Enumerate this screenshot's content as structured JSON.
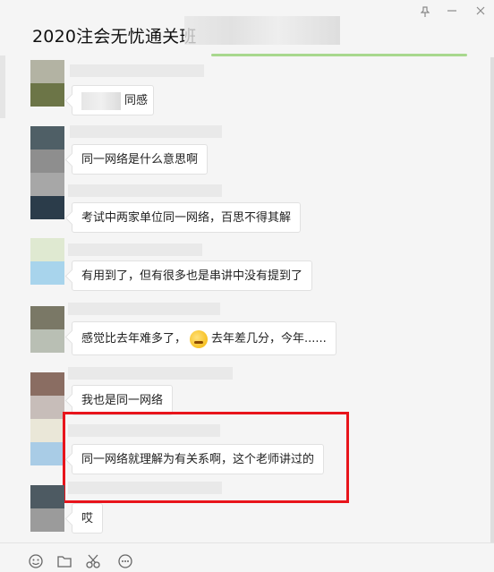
{
  "window": {
    "title": "2020注会无忧通关班",
    "pin_icon": "pin-icon"
  },
  "messages": [
    {
      "avatar": [
        "#b3b3a3",
        "#6c7547"
      ],
      "text": "同感",
      "leading_blur": true
    },
    {
      "avatar": [
        "#4f5f66",
        "#8e8e8e"
      ],
      "text": "同一网络是什么意思啊"
    },
    {
      "avatar": [
        "#a7a7a7",
        "#2b3c4a"
      ],
      "text": "考试中两家单位同一网络，百思不得其解"
    },
    {
      "avatar": [
        "#dfe9d1",
        "#a8d4ec"
      ],
      "text": "有用到了，但有很多也是串讲中没有提到了"
    },
    {
      "avatar": [
        "#7a7866",
        "#b9bfb4"
      ],
      "text": "感觉比去年难多了，",
      "emoji": "crying-laughing-emoji",
      "text_after": "去年差几分，今年......"
    },
    {
      "avatar": [
        "#8a6d62",
        "#c7bdb9"
      ],
      "text": "我也是同一网络"
    },
    {
      "avatar": [
        "#eae7d8",
        "#a9cce6"
      ],
      "text": "同一网络就理解为有关系啊，这个老师讲过的"
    },
    {
      "avatar": [
        "#4d5a62",
        "#9b9b9b"
      ],
      "text": "哎"
    }
  ],
  "toolbar": {
    "items": [
      "emoji-icon",
      "folder-icon",
      "scissors-icon",
      "chat-bubble-icon"
    ]
  },
  "colors": {
    "highlight": "#e8141b",
    "bubble": "#ffffff",
    "background": "#f5f5f5"
  }
}
